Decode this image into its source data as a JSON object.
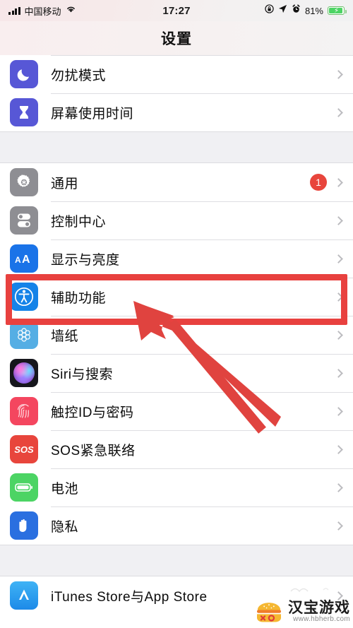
{
  "statusbar": {
    "carrier": "中国移动",
    "signal_icon": "signal-bars-icon",
    "wifi_icon": "wifi-icon",
    "time": "17:27",
    "rotation_lock_icon": "rotation-lock-icon",
    "location_icon": "location-arrow-icon",
    "alarm_icon": "alarm-clock-icon",
    "battery_percent": "81%",
    "battery_icon": "battery-charging-icon"
  },
  "navbar": {
    "title": "设置"
  },
  "groups": [
    {
      "id": "group-focus",
      "rows": [
        {
          "label": "勿扰模式",
          "icon": "moon-icon",
          "icon_class": "i-moon",
          "badge": null
        },
        {
          "label": "屏幕使用时间",
          "icon": "hourglass-icon",
          "icon_class": "i-hourglass",
          "badge": null
        }
      ]
    },
    {
      "id": "group-system",
      "rows": [
        {
          "label": "通用",
          "icon": "gear-icon",
          "icon_class": "i-gear",
          "badge": "1"
        },
        {
          "label": "控制中心",
          "icon": "toggles-icon",
          "icon_class": "i-toggles",
          "badge": null
        },
        {
          "label": "显示与亮度",
          "icon": "text-size-aa-icon",
          "icon_class": "i-aa",
          "badge": null
        },
        {
          "label": "辅助功能",
          "icon": "accessibility-icon",
          "icon_class": "i-access",
          "badge": null,
          "highlighted": true
        },
        {
          "label": "墙纸",
          "icon": "wallpaper-flower-icon",
          "icon_class": "i-wall",
          "badge": null
        },
        {
          "label": "Siri与搜索",
          "icon": "siri-orb-icon",
          "icon_class": "i-siri",
          "badge": null
        },
        {
          "label": "触控ID与密码",
          "icon": "fingerprint-icon",
          "icon_class": "i-touch",
          "badge": null
        },
        {
          "label": "SOS紧急联络",
          "icon": "sos-icon",
          "icon_class": "i-sos",
          "badge": null
        },
        {
          "label": "电池",
          "icon": "battery-icon",
          "icon_class": "i-batt",
          "badge": null
        },
        {
          "label": "隐私",
          "icon": "privacy-hand-icon",
          "icon_class": "i-hand",
          "badge": null
        }
      ]
    },
    {
      "id": "group-stores",
      "rows": [
        {
          "label": "iTunes Store与App Store",
          "icon": "app-store-icon",
          "icon_class": "i-store",
          "badge": null
        }
      ]
    }
  ],
  "annotation": {
    "highlight_row_label": "辅助功能",
    "box_color": "#e8413f",
    "arrow_color": "#e0433f",
    "arrow_icon": "pointer-arrow-icon"
  },
  "watermark": {
    "name": "汉宝游戏",
    "url": "www.hbherb.com",
    "logo_icon": "burger-logo-icon"
  },
  "colors": {
    "accent_red": "#e8453c",
    "list_bg": "#f0f0f3",
    "row_bg": "#ffffff",
    "separator": "#dedee2",
    "chevron": "#bcbcc0",
    "label_text": "#0b0b0b"
  }
}
